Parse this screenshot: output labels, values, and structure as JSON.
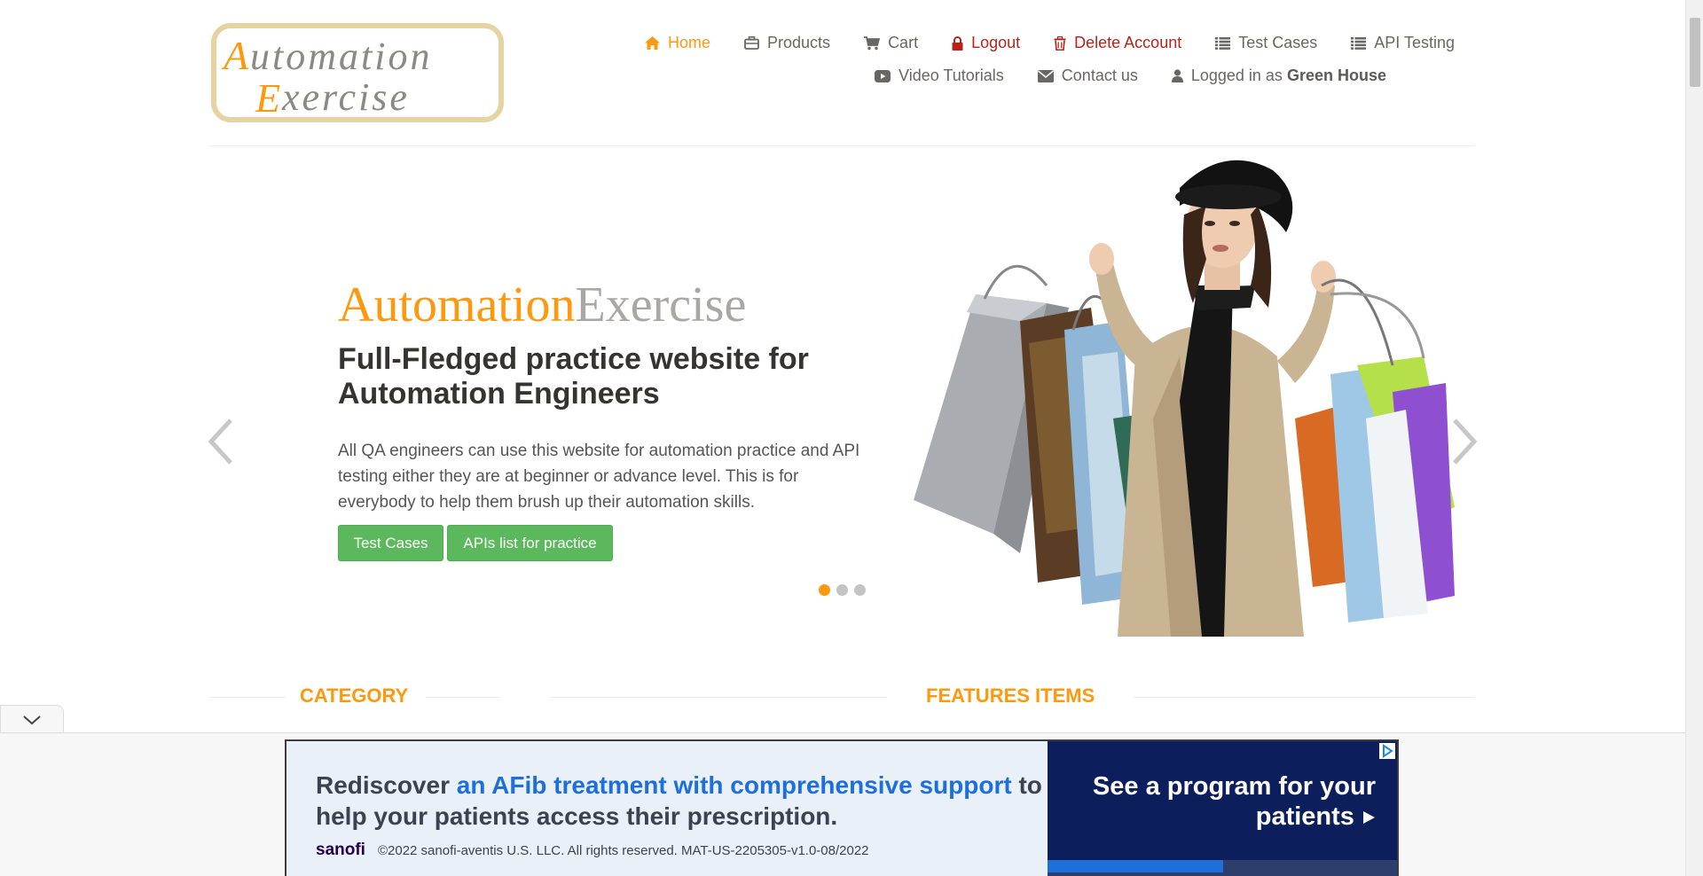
{
  "logo": {
    "line1": "Automation",
    "line2": "Exercise"
  },
  "nav": {
    "row1": [
      {
        "label": "Home",
        "icon": "home-icon"
      },
      {
        "label": "Products",
        "icon": "products-icon"
      },
      {
        "label": "Cart",
        "icon": "cart-icon"
      },
      {
        "label": "Logout",
        "icon": "lock-icon"
      },
      {
        "label": "Delete Account",
        "icon": "trash-icon"
      },
      {
        "label": "Test Cases",
        "icon": "list-icon"
      },
      {
        "label": "API Testing",
        "icon": "list-icon"
      }
    ],
    "row2": [
      {
        "label": "Video Tutorials",
        "icon": "youtube-icon"
      },
      {
        "label": "Contact us",
        "icon": "envelope-icon"
      }
    ],
    "logged_in_prefix": "Logged in as",
    "logged_in_user": "Green House"
  },
  "hero": {
    "brand_part1": "Automation",
    "brand_part2": "Exercise",
    "heading": "Full-Fledged practice website for Automation Engineers",
    "text": "All QA engineers can use this website for automation practice and API testing either they are at beginner or advance level. This is for everybody to help them brush up their automation skills.",
    "button1": "Test Cases",
    "button2": "APIs list for practice",
    "active_slide": 1,
    "slide_count": 3
  },
  "sections": {
    "category": "CATEGORY",
    "features": "FEATURES ITEMS"
  },
  "ad": {
    "copy_plain1": "Rediscover ",
    "copy_blue1": "an AFib treatment with comprehensive support",
    "copy_plain2": " to help your patients access their prescription.",
    "brand": "sanofi",
    "legal": "©2022 sanofi-aventis U.S. LLC. All rights reserved. MAT-US-2205305-v1.0-08/2022",
    "cta": "See a program for your patients",
    "progress": 0.5
  },
  "colors": {
    "accent": "#fe980f",
    "danger": "#b3241b",
    "button_green": "#5cb85c",
    "ad_navy": "#0c1e5b",
    "ad_blue": "#1e6fd9"
  }
}
